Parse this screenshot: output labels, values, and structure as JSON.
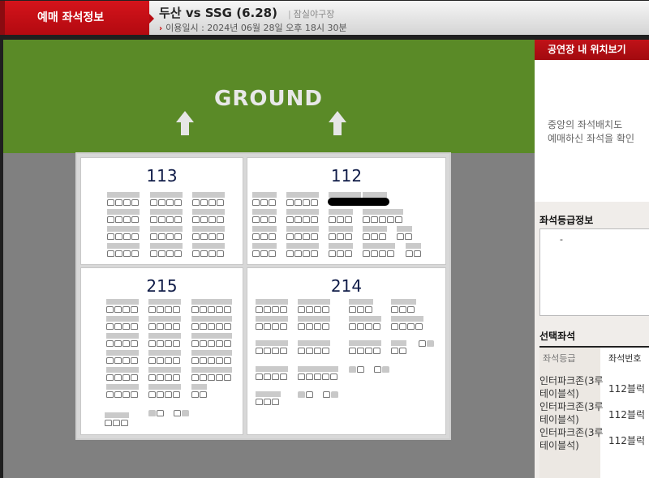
{
  "header": {
    "tab_label": "예매 좌석정보",
    "match_title": "두산 vs SSG (6.28)",
    "venue": "잠실야구장",
    "date_label": "이용일시 : 2024년 06월 28일 오후 18시 30분"
  },
  "map": {
    "ground_label": "GROUND",
    "blocks": [
      {
        "number": "113"
      },
      {
        "number": "112"
      },
      {
        "number": "215"
      },
      {
        "number": "214"
      }
    ]
  },
  "panel": {
    "location_title": "공연장 내 위치보기",
    "location_desc_line1": "중앙의 좌석배치도",
    "location_desc_line2": "예매하신 좌석을 확인",
    "grade_info_title": "좌석등급정보",
    "grade_info_value": "-",
    "selected_title": "선택좌석",
    "columns": [
      "좌석등급",
      "좌석번호"
    ],
    "rows": [
      {
        "grade": "인터파크존(3루 테이블석)",
        "seat": "112블럭"
      },
      {
        "grade": "인터파크존(3루 테이블석)",
        "seat": "112블럭"
      },
      {
        "grade": "인터파크존(3루 테이블석)",
        "seat": "112블럭"
      }
    ]
  },
  "colors": {
    "accent_red": "#c01218",
    "ground_green": "#5a8a27",
    "block_number": "#101c48"
  }
}
